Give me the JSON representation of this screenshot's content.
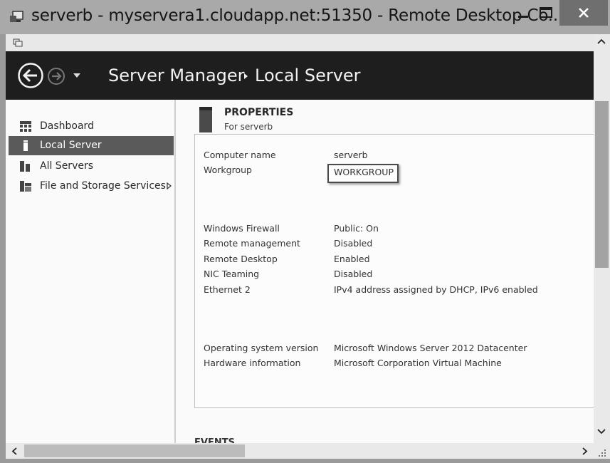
{
  "window": {
    "title": "serverb - myservera1.cloudapp.net:51350 - Remote Desktop Co...",
    "icon": "remote-desktop-icon",
    "controls": [
      "minimize-icon",
      "maximize-icon",
      "close-icon"
    ]
  },
  "header": {
    "app_title": "Server Manager",
    "separator": "▸",
    "page_title": "Local Server"
  },
  "nav": {
    "items": [
      {
        "label": "Dashboard",
        "icon": "dashboard-icon"
      },
      {
        "label": "Local Server",
        "icon": "local-server-icon",
        "selected": true
      },
      {
        "label": "All Servers",
        "icon": "all-servers-icon"
      },
      {
        "label": "File and Storage Services",
        "icon": "file-storage-icon",
        "has_submenu": true
      }
    ]
  },
  "properties": {
    "title": "PROPERTIES",
    "subtitle": "For serverb",
    "rows": [
      {
        "label": "Computer name",
        "value": "serverb"
      },
      {
        "label": "Workgroup",
        "value": "WORKGROUP"
      },
      {
        "label": "Windows Firewall",
        "value": "Public: On"
      },
      {
        "label": "Remote management",
        "value": "Disabled"
      },
      {
        "label": "Remote Desktop",
        "value": "Enabled"
      },
      {
        "label": "NIC Teaming",
        "value": "Disabled"
      },
      {
        "label": "Ethernet 2",
        "value": "IPv4 address assigned by DHCP, IPv6 enabled"
      },
      {
        "label": "Operating system version",
        "value": "Microsoft Windows Server 2012 Datacenter"
      },
      {
        "label": "Hardware information",
        "value": "Microsoft Corporation Virtual Machine"
      }
    ]
  },
  "events": {
    "title": "EVENTS"
  }
}
